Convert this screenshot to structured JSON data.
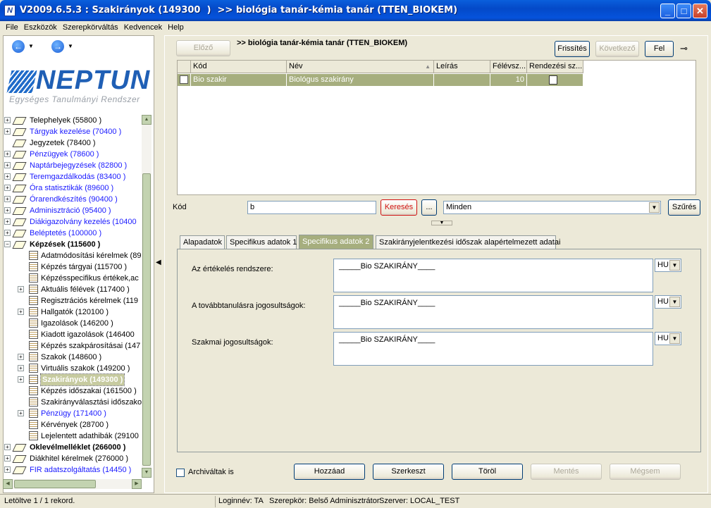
{
  "window": {
    "title": "V2009.6.5.3 : Szakirányok (149300  )  >> biológia tanár-kémia tanár (TTEN_BIOKEM)",
    "app_icon": "N"
  },
  "menu": [
    "File",
    "Eszközök",
    "Szerepkörváltás",
    "Kedvencek",
    "Help"
  ],
  "logo": {
    "name": "NEPTUN",
    "subtitle": "Egységes Tanulmányi Rendszer"
  },
  "tree": [
    {
      "label": "Telephelyek (55800  )",
      "level": 0,
      "expander": "+",
      "icon": "folder-icon",
      "style": "normal"
    },
    {
      "label": "Tárgyak kezelése (70400  )",
      "level": 0,
      "expander": "+",
      "icon": "folder-icon",
      "style": "link"
    },
    {
      "label": "Jegyzetek (78400  )",
      "level": 0,
      "expander": "",
      "icon": "folder-icon",
      "style": "normal"
    },
    {
      "label": "Pénzügyek (78600  )",
      "level": 0,
      "expander": "+",
      "icon": "folder-icon",
      "style": "link"
    },
    {
      "label": "Naptárbejegyzések (82800  )",
      "level": 0,
      "expander": "+",
      "icon": "folder-icon",
      "style": "link"
    },
    {
      "label": "Teremgazdálkodás (83400  )",
      "level": 0,
      "expander": "+",
      "icon": "folder-icon",
      "style": "link"
    },
    {
      "label": "Óra statisztikák (89600  )",
      "level": 0,
      "expander": "+",
      "icon": "folder-icon",
      "style": "link"
    },
    {
      "label": "Órarendkészítés (90400  )",
      "level": 0,
      "expander": "+",
      "icon": "folder-icon",
      "style": "link"
    },
    {
      "label": "Adminisztráció (95400  )",
      "level": 0,
      "expander": "+",
      "icon": "folder-icon",
      "style": "link"
    },
    {
      "label": "Diákigazolvány kezelés (10400",
      "level": 0,
      "expander": "+",
      "icon": "folder-icon",
      "style": "link"
    },
    {
      "label": "Beléptetés (100000  )",
      "level": 0,
      "expander": "+",
      "icon": "folder-icon",
      "style": "link"
    },
    {
      "label": "Képzések (115600  )",
      "level": 0,
      "expander": "−",
      "icon": "folder-icon",
      "style": "bold"
    },
    {
      "label": "Adatmódosítási kérelmek (89",
      "level": 1,
      "expander": "",
      "icon": "document-icon",
      "style": "normal"
    },
    {
      "label": "Képzés tárgyai (115700  )",
      "level": 1,
      "expander": "",
      "icon": "document-icon",
      "style": "normal"
    },
    {
      "label": "Képzésspecifikus értékek,ac",
      "level": 1,
      "expander": "",
      "icon": "document-icon",
      "style": "normal"
    },
    {
      "label": "Aktuális félévek (117400  )",
      "level": 1,
      "expander": "+",
      "icon": "document-icon",
      "style": "normal"
    },
    {
      "label": "Regisztrációs kérelmek (119",
      "level": 1,
      "expander": "",
      "icon": "document-icon",
      "style": "normal"
    },
    {
      "label": "Hallgatók (120100  )",
      "level": 1,
      "expander": "+",
      "icon": "document-icon",
      "style": "normal"
    },
    {
      "label": "Igazolások (146200  )",
      "level": 1,
      "expander": "",
      "icon": "document-icon",
      "style": "normal"
    },
    {
      "label": "Kiadott igazolások (146400",
      "level": 1,
      "expander": "",
      "icon": "document-icon",
      "style": "normal"
    },
    {
      "label": "Képzés szakpárosításai (147",
      "level": 1,
      "expander": "",
      "icon": "document-icon",
      "style": "normal"
    },
    {
      "label": "Szakok (148600  )",
      "level": 1,
      "expander": "+",
      "icon": "document-icon",
      "style": "normal"
    },
    {
      "label": "Virtuális szakok (149200  )",
      "level": 1,
      "expander": "+",
      "icon": "document-icon",
      "style": "normal"
    },
    {
      "label": "Szakirányok (149300  )",
      "level": 1,
      "expander": "+",
      "icon": "document-icon",
      "style": "selected"
    },
    {
      "label": "Képzés időszakai (161500  )",
      "level": 1,
      "expander": "",
      "icon": "document-icon",
      "style": "normal"
    },
    {
      "label": "Szakirányválasztási időszako",
      "level": 1,
      "expander": "",
      "icon": "document-icon",
      "style": "normal"
    },
    {
      "label": "Pénzügy (171400  )",
      "level": 1,
      "expander": "+",
      "icon": "document-icon",
      "style": "link"
    },
    {
      "label": "Kérvények (28700  )",
      "level": 1,
      "expander": "",
      "icon": "document-icon",
      "style": "normal"
    },
    {
      "label": "Lejelentett adathibák (29100",
      "level": 1,
      "expander": "",
      "icon": "document-icon",
      "style": "normal"
    },
    {
      "label": "Oklevélmelléklet (266000  )",
      "level": 0,
      "expander": "+",
      "icon": "folder-icon",
      "style": "bold"
    },
    {
      "label": "Diákhitel kérelmek (276000  )",
      "level": 0,
      "expander": "+",
      "icon": "folder-icon",
      "style": "normal"
    },
    {
      "label": "FIR adatszolgáltatás (14450  )",
      "level": 0,
      "expander": "+",
      "icon": "folder-icon",
      "style": "link"
    }
  ],
  "toolbar": {
    "prev": "Előző",
    "path": ">> biológia tanár-kémia tanár (TTEN_BIOKEM)",
    "refresh": "Frissítés",
    "next": "Következő",
    "up": "Fel"
  },
  "grid": {
    "columns": [
      "Kód",
      "Név",
      "Leírás",
      "Félévsz...",
      "Rendezési sz..."
    ],
    "rows": [
      {
        "kod": "Bio szakir",
        "nev": "Biológus szakirány",
        "leiras": "",
        "felevszam": "10"
      }
    ]
  },
  "filter": {
    "label": "Kód",
    "value": "b",
    "search": "Keresés",
    "more": "...",
    "scope": "Minden",
    "filter_btn": "Szűrés"
  },
  "tabs": [
    "Alapadatok",
    "Specifikus adatok 1",
    "Specifikus adatok 2",
    "Szakirányjelentkezési időszak alapértelmezett adatai"
  ],
  "active_tab": 2,
  "fields": [
    {
      "label": "Az értékelés rendszere:",
      "value": "_____Bio SZAKIRÁNY____",
      "lang": "HU"
    },
    {
      "label": "A továbbtanulásra jogosultságok:",
      "value": "_____Bio SZAKIRÁNY____",
      "lang": "HU"
    },
    {
      "label": "Szakmai jogosultságok:",
      "value": "_____Bio SZAKIRÁNY____",
      "lang": "HU"
    }
  ],
  "bottom": {
    "archived": "Archiváltak is",
    "add": "Hozzáad",
    "edit": "Szerkeszt",
    "delete": "Töröl",
    "save": "Mentés",
    "cancel": "Mégsem"
  },
  "status": {
    "records": "Letöltve 1 / 1 rekord.",
    "login": "Loginnév: TA",
    "role": "Szerepkör: Belső Adminisztrátor",
    "server": "Szerver: LOCAL_TEST"
  }
}
